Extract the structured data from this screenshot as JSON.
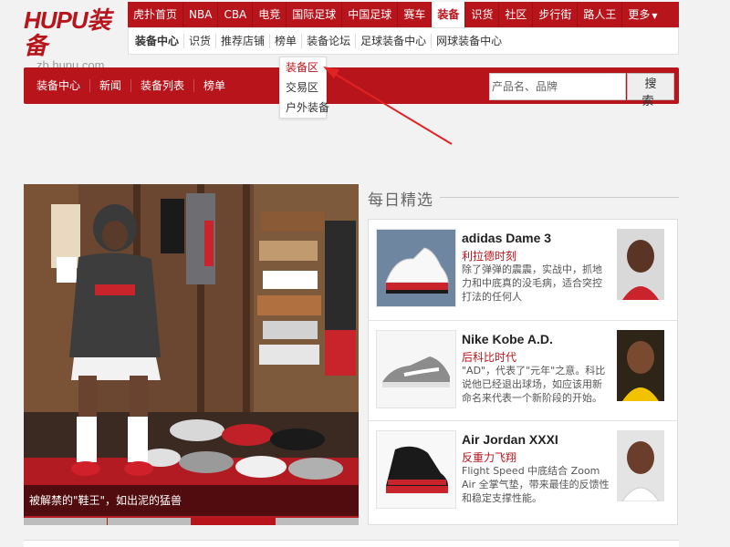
{
  "brand": {
    "name": "HUPU装备",
    "domain": "zb.hupu.com",
    "accent": "#b8141b"
  },
  "topnav": {
    "items": [
      "虎扑首页",
      "NBA",
      "CBA",
      "电竞",
      "国际足球",
      "中国足球",
      "赛车",
      "装备",
      "识货",
      "社区",
      "步行街",
      "路人王",
      "更多"
    ],
    "active_index": 7
  },
  "subnav": {
    "items": [
      "装备中心",
      "识货",
      "推荐店铺",
      "榜单",
      "装备论坛",
      "足球装备中心",
      "网球装备中心"
    ],
    "active_index": 0
  },
  "dropdown": {
    "items": [
      "装备区",
      "交易区",
      "户外装备"
    ],
    "highlighted": "装备区"
  },
  "redbar": {
    "items": [
      "装备中心",
      "新闻",
      "装备列表",
      "榜单"
    ]
  },
  "search": {
    "placeholder": "产品名、品牌",
    "button_label": "搜 索"
  },
  "hero": {
    "caption": "被解禁的\"鞋王\"，如出泥的猛兽",
    "slides": 4,
    "active_slide": 2
  },
  "daily": {
    "title": "每日精选",
    "items": [
      {
        "name": "adidas Dame 3",
        "sub": "利拉德时刻",
        "desc": "除了弹弹的震震，实战中，抓地力和中底真的没毛病，适合突控打法的任何人",
        "shoe_color": "#ffffff",
        "avatar": "player-avatar"
      },
      {
        "name": "Nike Kobe A.D.",
        "sub": "后科比时代",
        "desc": "\"AD\"，代表了\"元年\"之意。科比说他已经退出球场，如应该用新命名来代表一个新阶段的开始。",
        "shoe_color": "#888888",
        "avatar": "player-avatar"
      },
      {
        "name": "Air Jordan XXXI",
        "sub": "反重力飞翔",
        "desc": "Flight Speed 中底结合 Zoom Air 全掌气垫，带来最佳的反馈性和稳定支撑性能。",
        "shoe_color": "#b8141b",
        "avatar": "player-avatar"
      }
    ]
  }
}
